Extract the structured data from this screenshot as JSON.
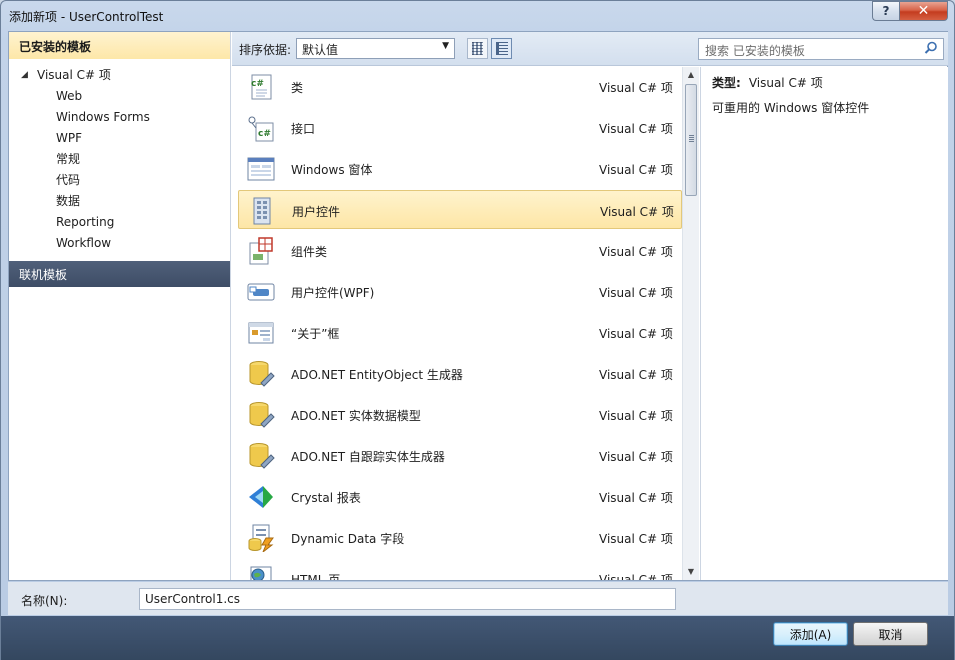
{
  "window": {
    "title": "添加新项 - UserControlTest",
    "help_label": "?",
    "close_label": "✕"
  },
  "left_panel": {
    "installed_header": "已安装的模板",
    "tree_root": "Visual C# 项",
    "tree_items": [
      "Web",
      "Windows Forms",
      "WPF",
      "常规",
      "代码",
      "数据",
      "Reporting",
      "Workflow"
    ],
    "online_header": "联机模板"
  },
  "toolbar": {
    "sort_label": "排序依据:",
    "sort_value": "默认值",
    "search_placeholder": "搜索 已安装的模板"
  },
  "templates": [
    {
      "name": "类",
      "type": "Visual C# 项",
      "icon": "csharp-class-icon"
    },
    {
      "name": "接口",
      "type": "Visual C# 项",
      "icon": "csharp-interface-icon"
    },
    {
      "name": "Windows 窗体",
      "type": "Visual C# 项",
      "icon": "windows-form-icon"
    },
    {
      "name": "用户控件",
      "type": "Visual C# 项",
      "icon": "user-control-icon",
      "selected": true
    },
    {
      "name": "组件类",
      "type": "Visual C# 项",
      "icon": "component-class-icon"
    },
    {
      "name": "用户控件(WPF)",
      "type": "Visual C# 项",
      "icon": "wpf-user-control-icon"
    },
    {
      "name": "“关于”框",
      "type": "Visual C# 项",
      "icon": "about-box-icon"
    },
    {
      "name": "ADO.NET EntityObject 生成器",
      "type": "Visual C# 项",
      "icon": "database-generator-icon"
    },
    {
      "name": "ADO.NET 实体数据模型",
      "type": "Visual C# 项",
      "icon": "entity-data-model-icon"
    },
    {
      "name": "ADO.NET 自跟踪实体生成器",
      "type": "Visual C# 项",
      "icon": "self-tracking-entity-icon"
    },
    {
      "name": "Crystal 报表",
      "type": "Visual C# 项",
      "icon": "crystal-report-icon"
    },
    {
      "name": "Dynamic Data 字段",
      "type": "Visual C# 项",
      "icon": "dynamic-data-icon"
    },
    {
      "name": "HTML 页",
      "type": "Visual C# 项",
      "icon": "html-page-icon"
    }
  ],
  "details": {
    "type_label": "类型:",
    "type_value": "Visual C# 项",
    "description": "可重用的 Windows 窗体控件"
  },
  "name_field": {
    "label": "名称(N):",
    "value": "UserControl1.cs"
  },
  "buttons": {
    "add": "添加(A)",
    "cancel": "取消"
  },
  "colors": {
    "selection": "#fde6a6",
    "online_header": "#46566f",
    "footer": "#3b4e69"
  }
}
